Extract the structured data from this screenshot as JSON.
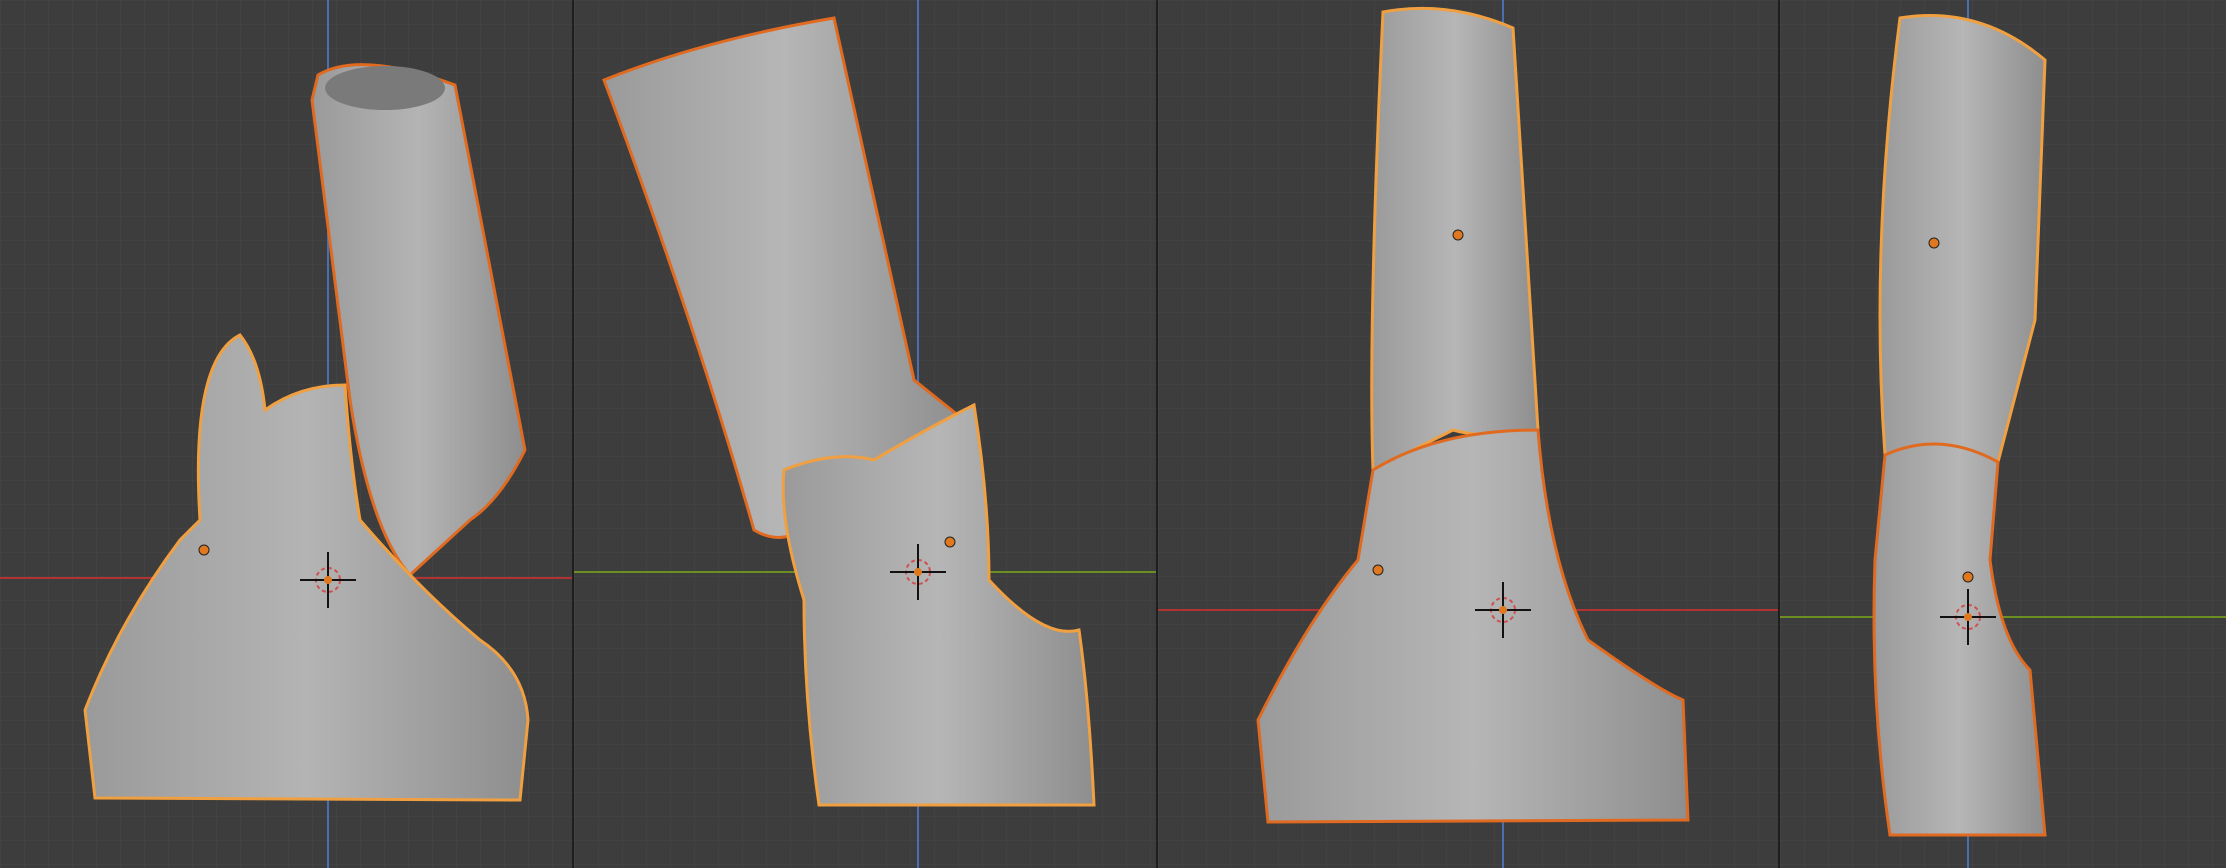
{
  "window": {
    "title": ""
  },
  "colors": {
    "viewport_bg": "#3d3d3d",
    "grid_minor": "#454545",
    "grid_major": "#4f4f4f",
    "axis_x": "#b03232",
    "axis_y": "#6b8f23",
    "axis_z": "#4a6fb0",
    "mesh_fill": "#a8a8a8",
    "mesh_shade": "#8c8c8c",
    "selection_outline_active": "#f0a040",
    "selection_outline": "#e06a20",
    "origin_dot": "#e07820",
    "cursor_ring": "#d05050"
  },
  "viewports": [
    {
      "id": "vp1",
      "label": ""
    },
    {
      "id": "vp2",
      "label": ""
    },
    {
      "id": "vp3",
      "label": ""
    },
    {
      "id": "vp4",
      "label": ""
    }
  ]
}
